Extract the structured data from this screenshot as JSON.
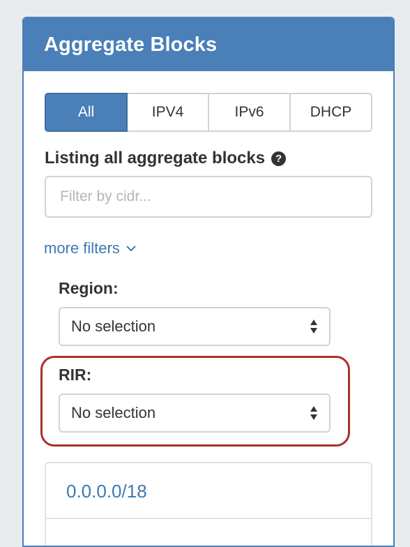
{
  "panel": {
    "title": "Aggregate Blocks"
  },
  "tabs": [
    {
      "label": "All",
      "active": true
    },
    {
      "label": "IPV4",
      "active": false
    },
    {
      "label": "IPv6",
      "active": false
    },
    {
      "label": "DHCP",
      "active": false
    }
  ],
  "listing": {
    "label": "Listing all aggregate blocks",
    "help_icon": "question-circle-icon"
  },
  "filter": {
    "placeholder": "Filter by cidr...",
    "value": ""
  },
  "more_filters": {
    "label": "more filters",
    "icon": "chevron-down-icon"
  },
  "region": {
    "label": "Region:",
    "selected": "No selection"
  },
  "rir": {
    "label": "RIR:",
    "selected": "No selection"
  },
  "blocks": [
    {
      "cidr": "0.0.0.0/18"
    }
  ],
  "colors": {
    "header": "#4a7fb8",
    "link": "#3f78b5",
    "highlight": "#a8322a",
    "text": "#333333"
  }
}
